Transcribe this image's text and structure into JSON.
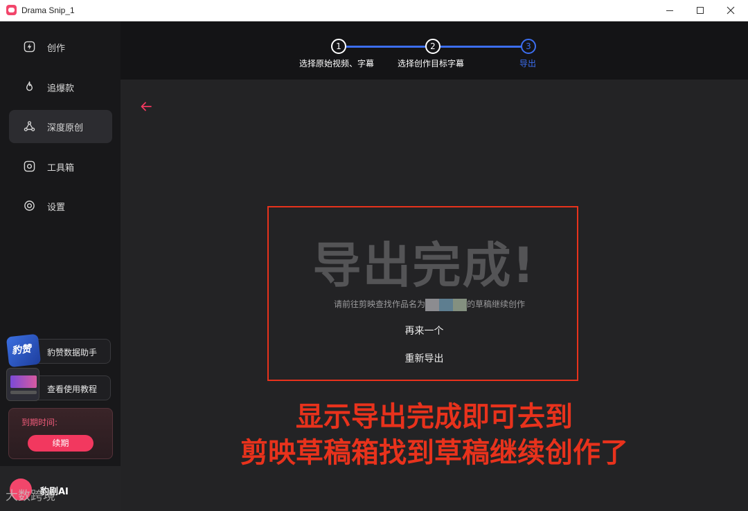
{
  "window": {
    "title": "Drama Snip_1"
  },
  "sidebar": {
    "items": [
      {
        "label": "创作",
        "icon": "lightning-icon"
      },
      {
        "label": "追爆款",
        "icon": "flame-icon"
      },
      {
        "label": "深度原创",
        "icon": "network-icon"
      },
      {
        "label": "工具箱",
        "icon": "toolbox-icon"
      },
      {
        "label": "设置",
        "icon": "settings-icon"
      }
    ],
    "active_index": 2,
    "helper_label": "豹赞数据助手",
    "tutorial_label": "查看使用教程",
    "expire_label": "到期时间:",
    "renew_label": "续期",
    "brand_name": "豹剧AI"
  },
  "steps": [
    {
      "number": "1",
      "label": "选择原始视频、字幕"
    },
    {
      "number": "2",
      "label": "选择创作目标字幕"
    },
    {
      "number": "3",
      "label": "导出"
    }
  ],
  "current_step": 3,
  "main": {
    "done_title": "导出完成!",
    "hint_prefix": "请前往剪映查找作品名为",
    "hint_suffix": "的草稿继续创作",
    "again_label": "再来一个",
    "reexport_label": "重新导出"
  },
  "annotation": {
    "line1": "显示导出完成即可去到",
    "line2": "剪映草稿箱找到草稿继续创作了"
  },
  "watermark": "大数跨境",
  "colors": {
    "accent_blue": "#3c6ef0",
    "accent_pink": "#f2385f",
    "annotation_red": "#e8321c"
  }
}
